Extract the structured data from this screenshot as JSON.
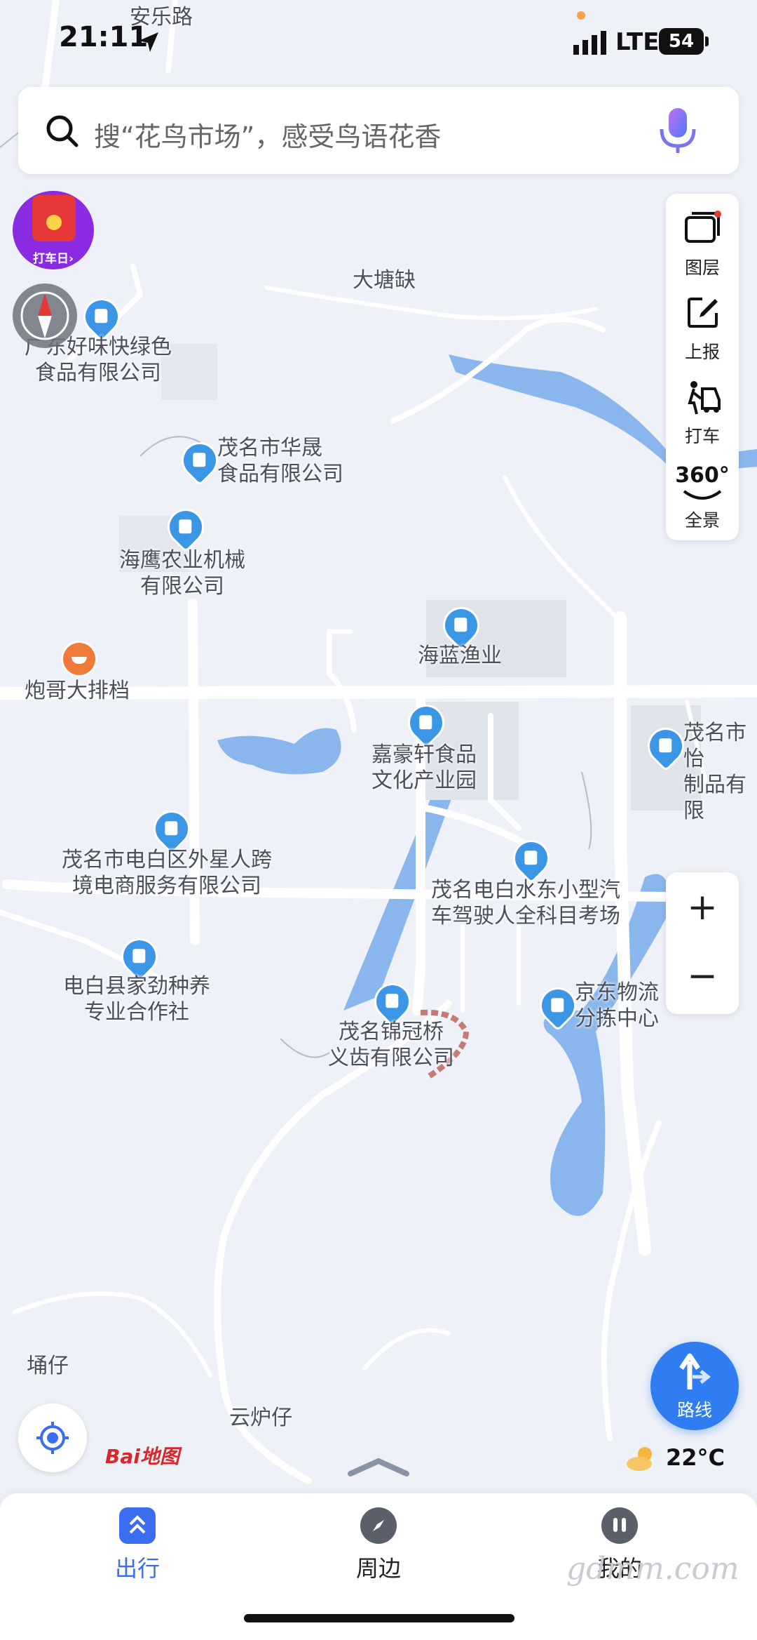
{
  "status": {
    "time": "21:11",
    "network": "LTE",
    "battery": "54"
  },
  "search": {
    "placeholder": "搜“花鸟市场”，感受鸟语花香"
  },
  "promo": {
    "label": "打车日›"
  },
  "side_tools": [
    {
      "label": "图层",
      "icon": "layers-icon"
    },
    {
      "label": "上报",
      "icon": "report-icon"
    },
    {
      "label": "打车",
      "icon": "taxi-icon"
    },
    {
      "label": "全景",
      "icon": "panorama-360-icon",
      "badge": "360°"
    }
  ],
  "zoom": {
    "in": "+",
    "out": "−"
  },
  "map_labels": {
    "road_top": "安乐路",
    "datangque": "大塘缺",
    "haowei": "广东好味快绿色\n食品有限公司",
    "huasheng": "茂名市华晟\n食品有限公司",
    "haiying": "海鹰农业机械\n有限公司",
    "hailan": "海蓝渔业",
    "paoge": "炮哥大排档",
    "jiahaoxuan": "嘉豪轩食品\n文化产业园",
    "maoming_right": "茂名市怡\n制品有限",
    "waixingren": "茂名市电白区外星人跨\n境电商服务有限公司",
    "shuidong": "茂名电白水东小型汽\n车驾驶人全科目考场",
    "jiajin": "电白县家劲种养\n专业合作社",
    "jinguanqiao": "茂名锦冠桥\n义齿有限公司",
    "jingdong": "京东物流\n分拣中心",
    "yongzai": "埇仔",
    "yunluzai": "云炉仔"
  },
  "logo": {
    "text": "Bai地图"
  },
  "weather": {
    "temp": "22°C"
  },
  "route_button": {
    "label": "路线"
  },
  "tabs": [
    {
      "label": "出行",
      "active": true,
      "color": "#3a6df0"
    },
    {
      "label": "周边",
      "active": false,
      "color": "#222222"
    },
    {
      "label": "我的",
      "active": false,
      "color": "#222222"
    }
  ],
  "watermark": "gdmm.com",
  "colors": {
    "accent": "#3a6df0",
    "water": "#8ab6ee",
    "map_bg": "#eef1f7",
    "poi": "#3b97e6"
  }
}
